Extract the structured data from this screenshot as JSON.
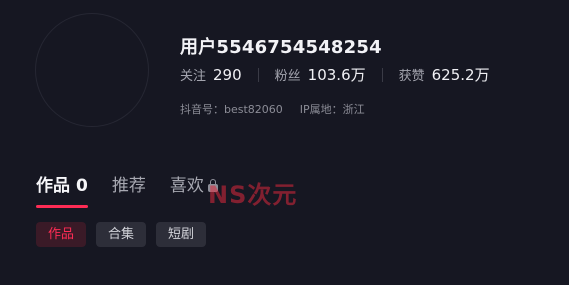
{
  "profile": {
    "username": "用户5546754548254",
    "stats": [
      {
        "label": "关注",
        "value": "290"
      },
      {
        "label": "粉丝",
        "value": "103.6万"
      },
      {
        "label": "获赞",
        "value": "625.2万"
      }
    ],
    "douyin_id": "抖音号：best82060",
    "ip_location": "IP属地：浙江"
  },
  "tabs": [
    {
      "label": "作品",
      "count": "0",
      "active": true
    },
    {
      "label": "推荐",
      "active": false
    },
    {
      "label": "喜欢",
      "icon": "lock-icon",
      "active": false
    }
  ],
  "watermark": "NS次元",
  "filters": [
    {
      "label": "作品",
      "active": true
    },
    {
      "label": "合集",
      "active": false
    },
    {
      "label": "短剧",
      "active": false
    }
  ],
  "colors": {
    "background": "#161722",
    "accent": "#fe2c55",
    "chip_background": "#2d2e39"
  }
}
